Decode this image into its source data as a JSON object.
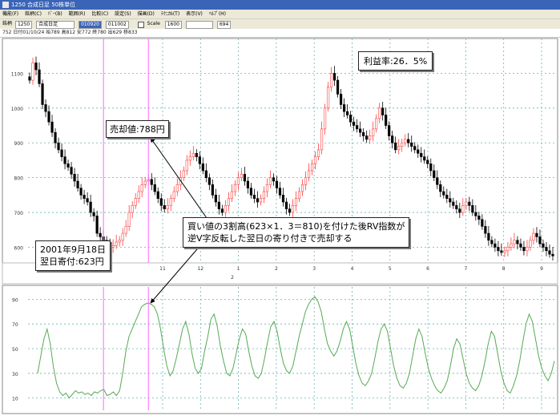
{
  "window": {
    "title": "1250 合成日足 50株単位"
  },
  "menu": {
    "items": [
      "機能(F)",
      "銘柄(C)",
      "ﾊﾞｰ(B)",
      "範囲(R)",
      "比較(C)",
      "設定(S)",
      "描画(D)",
      "ﾃｸﾆｶﾙ(T)",
      "表示(V)",
      "ﾍﾙﾌﾟ(H)"
    ]
  },
  "toolbar": {
    "code_label": "銘柄",
    "code_value": "1250",
    "name_value": "合成日足",
    "range_start": "010920",
    "range_end": "011002",
    "scale_label": "Scale",
    "period_value": "1600",
    "count_value": "694"
  },
  "infobar": {
    "text": "752 日付01/10/24 始789 高812 安772 終780 出629 移833"
  },
  "annotations": {
    "profit": "利益率:26．5%",
    "sell": "売却値:788円",
    "buy_line1": "2001年9月18日",
    "buy_line2": "翌日寄付:623円",
    "explain_line1": "買い値の3割高(623×1．3＝810)を付けた後RV指数が",
    "explain_line2": "逆V字反転した翌日の寄り付きで売却する"
  },
  "chart_data": [
    {
      "type": "candlestick",
      "y_ticks": [
        600,
        700,
        800,
        900,
        1000,
        1100
      ],
      "ylim": [
        555,
        1200
      ],
      "x_month_labels": [
        "11",
        "12",
        "1",
        "2",
        "3",
        "4",
        "5",
        "6",
        "7",
        "8",
        "9"
      ],
      "x_sub_label": "2",
      "colors": {
        "up": "#ff4040",
        "down": "#000000",
        "grid": "#66b3b3",
        "marker": "#ff66ff"
      },
      "closes": [
        1080,
        1130,
        1110,
        1070,
        1010,
        990,
        960,
        930,
        900,
        880,
        860,
        840,
        830,
        810,
        790,
        770,
        750,
        740,
        730,
        700,
        690,
        640,
        630,
        620,
        610,
        600,
        605,
        615,
        620,
        640,
        660,
        700,
        720,
        740,
        760,
        780,
        790,
        795,
        780,
        760,
        740,
        720,
        710,
        720,
        740,
        760,
        780,
        800,
        820,
        850,
        860,
        870,
        860,
        840,
        820,
        800,
        780,
        750,
        730,
        710,
        700,
        720,
        740,
        760,
        780,
        800,
        810,
        790,
        770,
        750,
        740,
        730,
        740,
        760,
        780,
        800,
        790,
        770,
        750,
        730,
        710,
        700,
        720,
        740,
        760,
        780,
        800,
        820,
        840,
        860,
        880,
        940,
        1000,
        1060,
        1100,
        1080,
        1040,
        1010,
        990,
        980,
        960,
        950,
        940,
        930,
        920,
        910,
        920,
        940,
        970,
        1000,
        980,
        950,
        920,
        900,
        880,
        890,
        900,
        910,
        900,
        890,
        880,
        870,
        860,
        850,
        840,
        820,
        800,
        780,
        760,
        750,
        740,
        730,
        720,
        710,
        700,
        720,
        730,
        720,
        700,
        690,
        680,
        660,
        640,
        620,
        610,
        600,
        590,
        585,
        590,
        600,
        610,
        620,
        610,
        600,
        590,
        600,
        620,
        640,
        630,
        610,
        600,
        590,
        580,
        575
      ],
      "sell_index": 37,
      "buy_index": 23
    },
    {
      "type": "line",
      "name": "",
      "y_ticks": [
        10,
        30,
        50,
        70,
        90
      ],
      "ylim": [
        0,
        100
      ],
      "colors": {
        "line": "#55aa55"
      },
      "values": [
        30,
        44,
        58,
        66,
        54,
        35,
        22,
        15,
        12,
        14,
        10,
        13,
        16,
        14,
        15,
        13,
        14,
        12,
        15,
        14,
        16,
        17,
        12,
        13,
        15,
        12,
        16,
        30,
        48,
        60,
        66,
        72,
        78,
        84,
        86,
        87,
        86,
        84,
        78,
        66,
        50,
        36,
        28,
        32,
        42,
        54,
        66,
        72,
        62,
        46,
        34,
        30,
        34,
        48,
        60,
        74,
        78,
        68,
        52,
        40,
        30,
        28,
        34,
        46,
        58,
        66,
        62,
        48,
        36,
        28,
        26,
        30,
        42,
        56,
        68,
        72,
        64,
        50,
        38,
        32,
        30,
        36,
        48,
        60,
        70,
        80,
        86,
        90,
        92,
        88,
        80,
        66,
        54,
        48,
        44,
        48,
        56,
        66,
        72,
        66,
        52,
        38,
        28,
        22,
        20,
        24,
        30,
        42,
        56,
        66,
        70,
        64,
        50,
        36,
        26,
        20,
        18,
        22,
        30,
        44,
        58,
        66,
        60,
        46,
        34,
        26,
        20,
        16,
        14,
        18,
        24,
        36,
        50,
        58,
        54,
        42,
        30,
        22,
        18,
        16,
        20,
        28,
        40,
        54,
        64,
        60,
        46,
        32,
        22,
        16,
        14,
        20,
        28,
        40,
        56,
        70,
        78,
        72,
        58,
        44,
        34,
        28,
        24,
        30,
        40
      ]
    }
  ]
}
